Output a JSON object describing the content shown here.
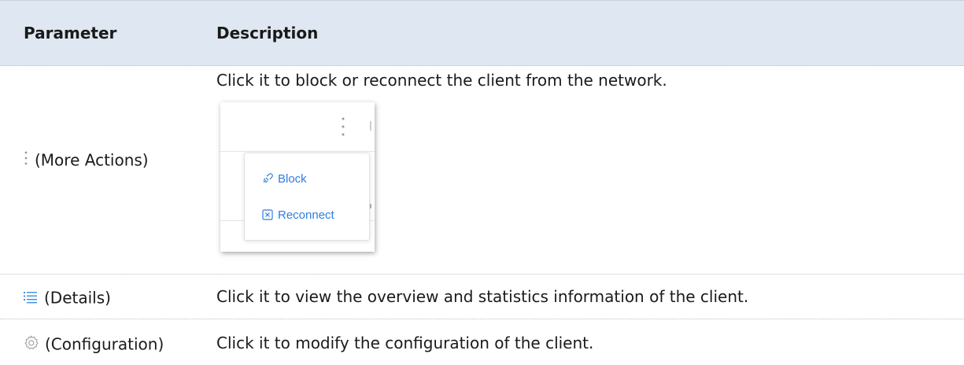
{
  "table": {
    "headers": {
      "parameter": "Parameter",
      "description": "Description"
    },
    "rows": [
      {
        "icon": "vertical-ellipsis-icon",
        "parameter": "(More Actions)",
        "description": "Click it to block or reconnect the client from the network.",
        "menu": {
          "items": [
            {
              "icon": "block-link-icon",
              "label": "Block"
            },
            {
              "icon": "reconnect-box-x-icon",
              "label": "Reconnect"
            }
          ]
        }
      },
      {
        "icon": "list-details-icon",
        "parameter": "(Details)",
        "description": "Click it to view the overview and statistics information of the client."
      },
      {
        "icon": "gear-icon",
        "parameter": "(Configuration)",
        "description": "Click it to modify the configuration of the client."
      }
    ]
  },
  "colors": {
    "header_bg": "#dfe7f2",
    "menu_link": "#2f7de1",
    "icon_blue": "#3a8ee6",
    "icon_gray": "#9a9a9a"
  }
}
